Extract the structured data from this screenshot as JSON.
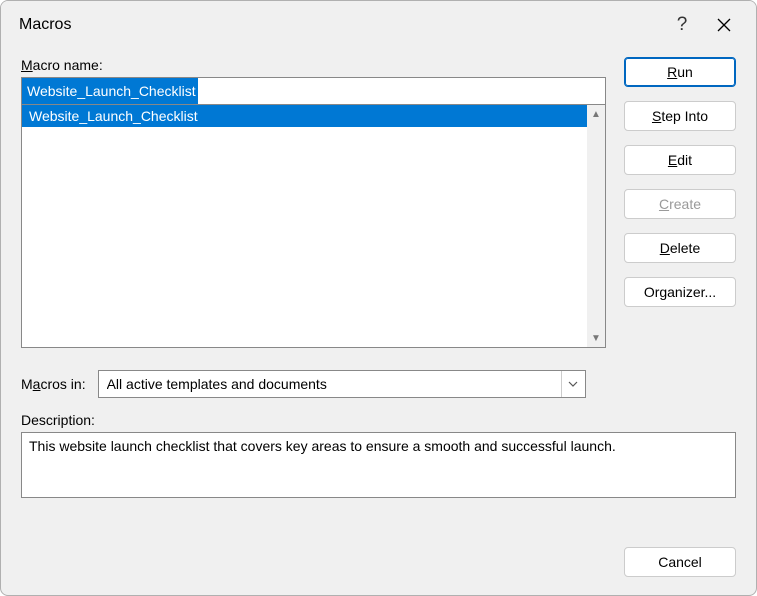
{
  "dialog": {
    "title": "Macros"
  },
  "labels": {
    "macro_name": "acro name:",
    "macro_name_prefix": "M",
    "macros_in": "cros in:",
    "macros_in_prefix": "M",
    "macros_in_underline": "a",
    "description": "Description:"
  },
  "input": {
    "macro_name_value": "Website_Launch_Checklist"
  },
  "list": {
    "items": [
      "Website_Launch_Checklist"
    ]
  },
  "dropdown": {
    "selected": "All active templates and documents"
  },
  "description_text": "This website launch checklist that covers key areas to ensure a smooth and successful launch.",
  "buttons": {
    "run": "un",
    "run_underline": "R",
    "step_into": "tep Into",
    "step_into_underline": "S",
    "edit": "dit",
    "edit_underline": "E",
    "create": "reate",
    "create_underline": "C",
    "delete": "elete",
    "delete_underline": "D",
    "organizer": "Organizer...",
    "cancel": "Cancel"
  }
}
